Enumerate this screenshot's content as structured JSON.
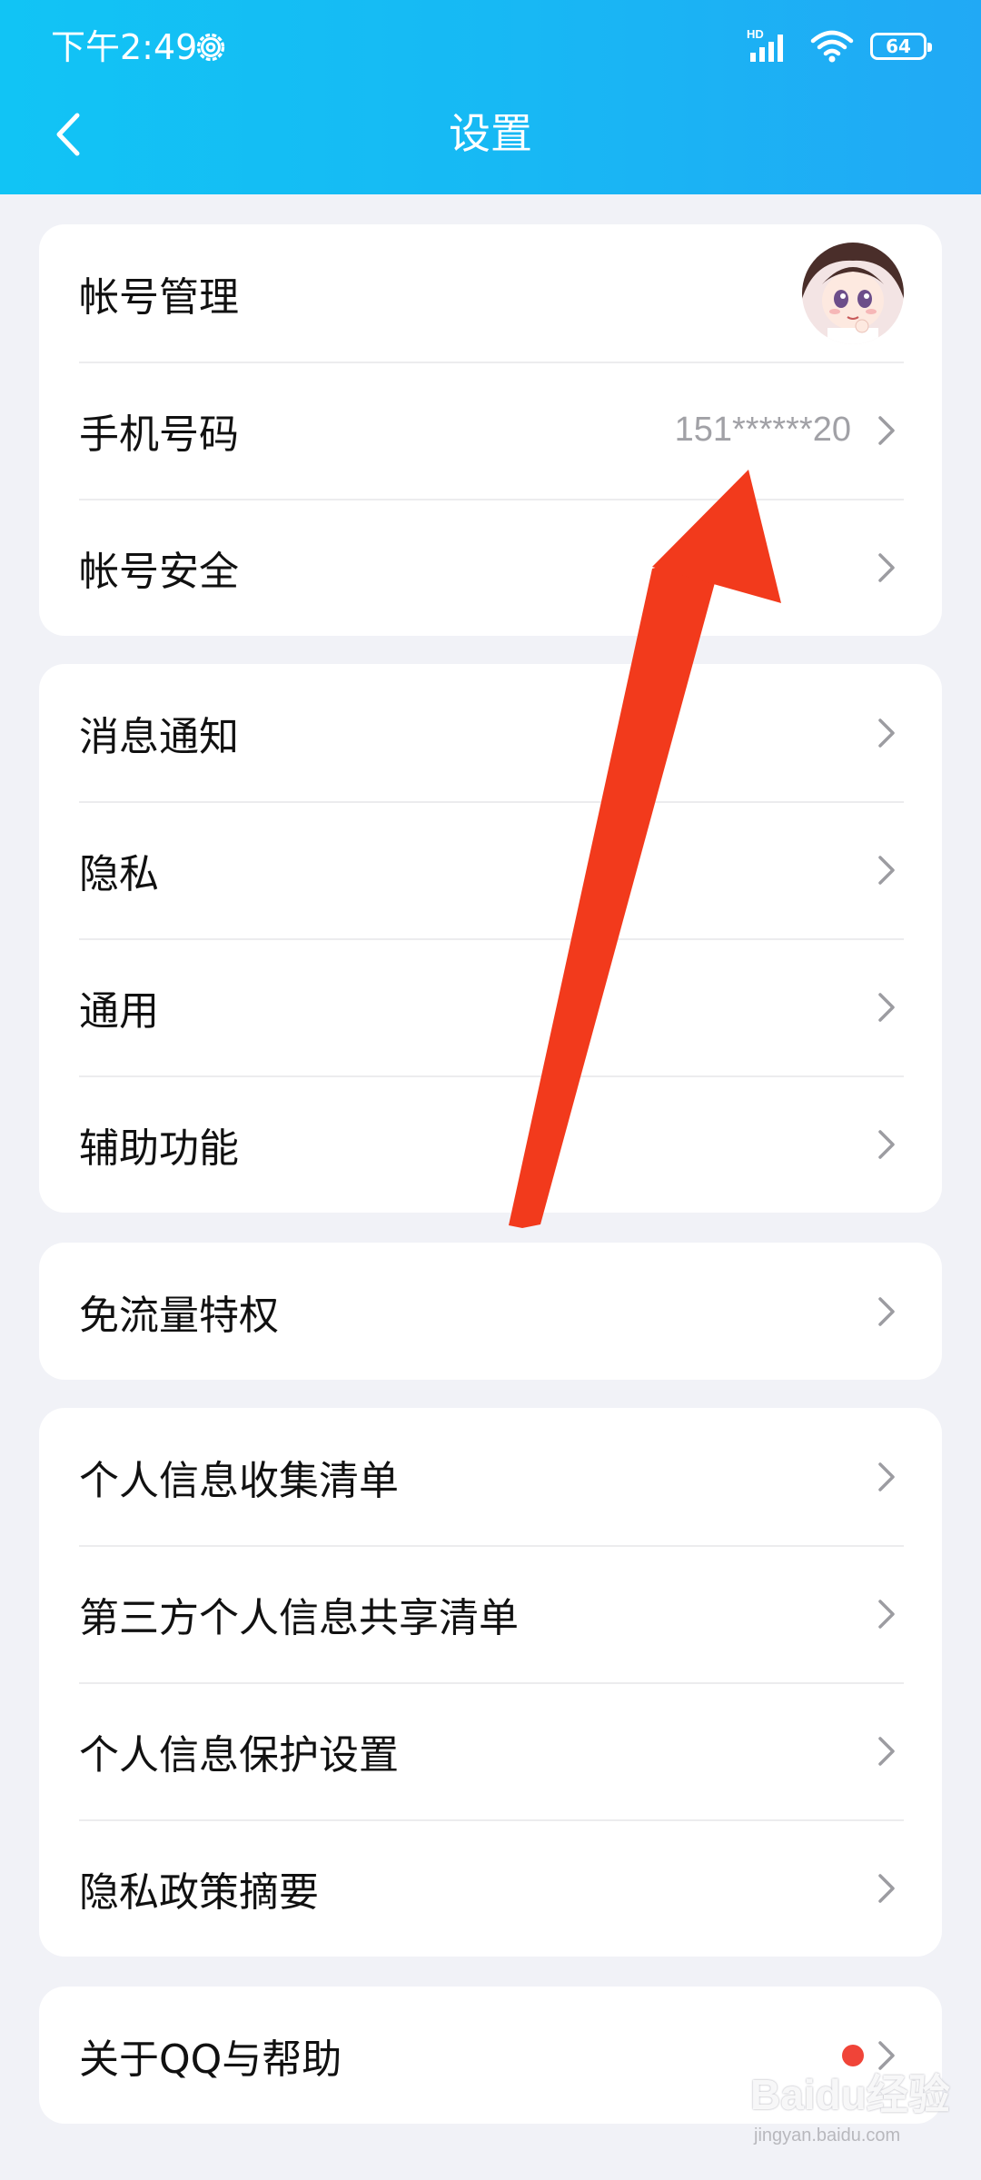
{
  "status_bar": {
    "time": "下午2:49",
    "network_label": "HD",
    "battery": "64"
  },
  "header": {
    "title": "设置"
  },
  "groups": [
    {
      "items": [
        {
          "label": "帐号管理"
        },
        {
          "label": "手机号码",
          "value": "151******20"
        },
        {
          "label": "帐号安全"
        }
      ]
    },
    {
      "items": [
        {
          "label": "消息通知"
        },
        {
          "label": "隐私"
        },
        {
          "label": "通用"
        },
        {
          "label": "辅助功能"
        }
      ]
    },
    {
      "items": [
        {
          "label": "免流量特权"
        }
      ]
    },
    {
      "items": [
        {
          "label": "个人信息收集清单"
        },
        {
          "label": "第三方个人信息共享清单"
        },
        {
          "label": "个人信息保护设置"
        },
        {
          "label": "隐私政策摘要"
        }
      ]
    },
    {
      "items": [
        {
          "label": "关于QQ与帮助"
        }
      ]
    }
  ],
  "watermark": {
    "brand": "Baidu经验",
    "url": "jingyan.baidu.com"
  },
  "colors": {
    "header_gradient_start": "#11c4f5",
    "header_gradient_end": "#21a9f5",
    "background": "#f1f2f7",
    "annotation_arrow": "#f23a1c",
    "notification_dot": "#f04438"
  },
  "icons": {
    "back": "chevron-left-icon",
    "row_arrow": "chevron-right-icon",
    "status_settings": "gear-icon",
    "wifi": "wifi-icon",
    "signal": "signal-icon",
    "battery": "battery-icon"
  }
}
